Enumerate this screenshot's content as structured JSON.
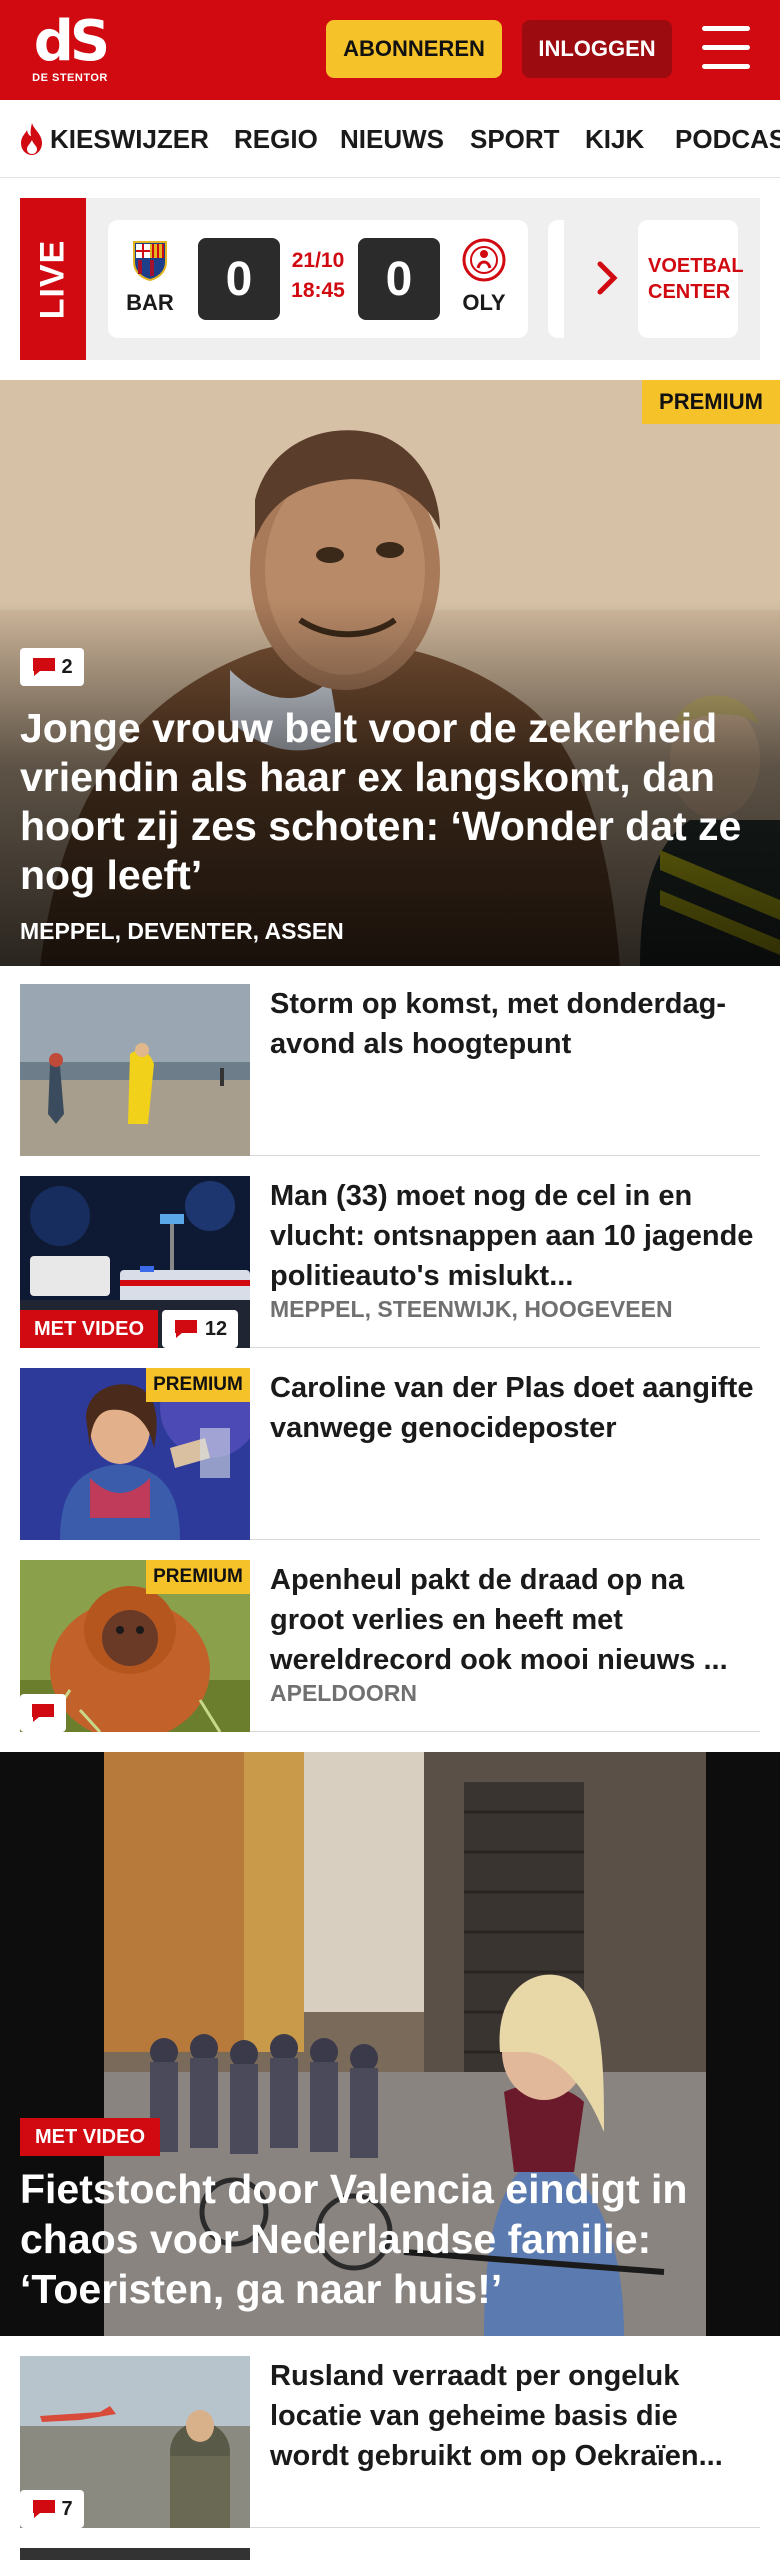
{
  "header": {
    "logo_mark": "dS",
    "logo_sub": "DE STENTOR",
    "subscribe_label": "ABONNEREN",
    "login_label": "INLOGGEN",
    "brand_color": "#d10a11"
  },
  "nav": {
    "items": [
      {
        "label": "KIESWIJZER",
        "icon": "flame-icon"
      },
      {
        "label": "REGIO"
      },
      {
        "label": "NIEUWS"
      },
      {
        "label": "SPORT"
      },
      {
        "label": "KIJK"
      },
      {
        "label": "PODCAS"
      }
    ]
  },
  "live": {
    "tag": "LIVE",
    "match": {
      "home": "BAR",
      "home_score": "0",
      "away": "OLY",
      "away_score": "0",
      "date": "21/10",
      "time": "18:45"
    },
    "football_center": "VOETBAL CENTER"
  },
  "hero": {
    "badge": "PREMIUM",
    "comments": "2",
    "title": "Jonge vrouw belt voor de zekerheid vriendin als haar ex langskomt, dan hoort zij zes schoten: ‘Wonder dat ze nog leeft’",
    "location": "MEPPEL, DEVENTER, ASSEN"
  },
  "articles": [
    {
      "title": "Storm op komst, met donderdag­avond als hoogtepunt"
    },
    {
      "title": "Man (33) moet nog de cel in en vlucht: ontsnappen aan 10 jagende politieauto's mislukt...",
      "location": "MEPPEL, STEENWIJK, HOOGEVEEN",
      "video_label": "MET VIDEO",
      "comments": "12"
    },
    {
      "title": "Caroline van der Plas doet aangifte vanwege genocidepos­ter",
      "badge": "PREMIUM"
    },
    {
      "title": "Apenheul pakt de draad op na groot verlies en heeft met wereldrecord ook mooi nieuws ...",
      "location": "APELDOORN",
      "badge": "PREMIUM"
    }
  ],
  "video_hero": {
    "video_label": "MET VIDEO",
    "title": "Fietstocht door Valencia eindigt in chaos voor Nederlandse familie: ‘Toeristen, ga naar huis!’"
  },
  "articles2": [
    {
      "title": "Rusland verraadt per ongeluk locatie van geheime basis die wordt gebruikt om op Oekraïen...",
      "comments": "7"
    }
  ]
}
